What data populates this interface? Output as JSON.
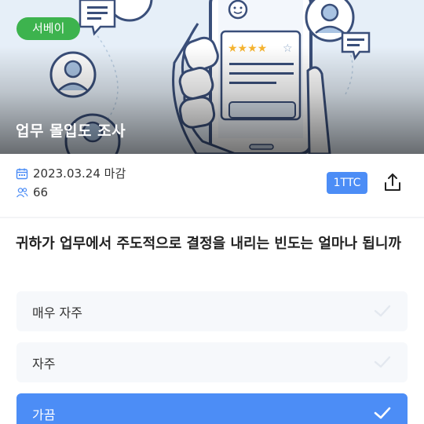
{
  "survey": {
    "category_badge": "서베이",
    "title": "업무 몰입도 조사",
    "deadline": "2023.03.24 마감",
    "participants": "66",
    "reward_tag": "1TTC",
    "icons": {
      "calendar": "calendar-icon",
      "people": "people-icon",
      "share": "share-icon"
    }
  },
  "question": {
    "text": "귀하가 업무에서 주도적으로 결정을 내리는 빈도는 얼마나 됩니까",
    "options": [
      {
        "label": "매우 자주",
        "selected": false
      },
      {
        "label": "자주",
        "selected": false
      },
      {
        "label": "가끔",
        "selected": true
      }
    ]
  },
  "colors": {
    "badge_green": "#3db34e",
    "accent_blue": "#4c8df6",
    "option_bg": "#f6f8fb"
  }
}
